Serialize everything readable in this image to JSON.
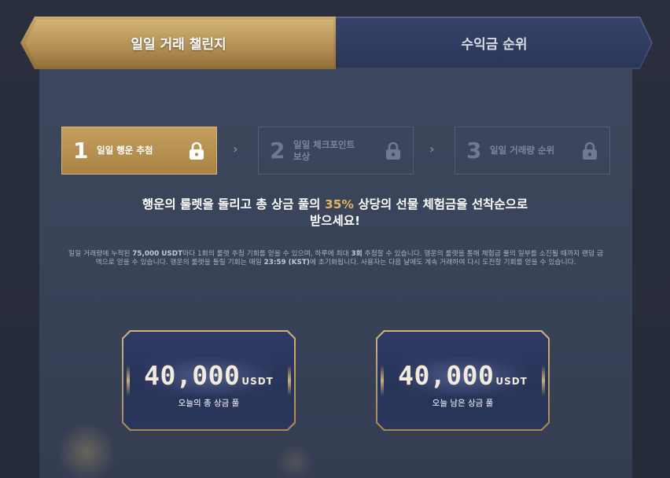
{
  "tabs": [
    {
      "label": "일일 거래 챌린지",
      "active": true
    },
    {
      "label": "수익금 순위",
      "active": false
    }
  ],
  "steps": [
    {
      "number": "1",
      "label": "일일 행운 추첨",
      "active": true,
      "icon": "lock-icon"
    },
    {
      "number": "2",
      "label_line1": "일일 체크포인트",
      "label_line2": "보상",
      "active": false,
      "icon": "lock-icon"
    },
    {
      "number": "3",
      "label": "일일 거래량 순위",
      "active": false,
      "icon": "lock-icon"
    }
  ],
  "headline": {
    "line1_before": "행운의 룰렛을 돌리고 총 상금 풀의 ",
    "percent": "35%",
    "line1_after": " 상당의 선물 체험금을 선착순으로",
    "line2": "받으세요!"
  },
  "description": {
    "p1": "일일 거래량에 누적된 ",
    "amount": "75,000 USDT",
    "p2": "마다 1회의 룰렛 추첨 기회를 얻을 수 있으며, 하루에 최대 ",
    "max": "3회",
    "p3": " 추첨할 수 있습니다. 행운의 룰렛을 통해 체험금 풀의 일부를 소진될 때까지 랜덤 금액으로 얻을 수 있습니다. 행운의 룰렛을 돌릴 기회는 매일 ",
    "time": "23:59 (KST)",
    "p4": "에 초기화됩니다. 사용자는 다음 날에도 계속 거래하여 다시 도전할 기회를 얻을 수 있습니다."
  },
  "prize_cards": [
    {
      "amount": "40,000",
      "unit": "USDT",
      "label": "오늘의 총 상금 풀"
    },
    {
      "amount": "40,000",
      "unit": "USDT",
      "label": "오늘 남은 상금 풀"
    }
  ],
  "colors": {
    "gold": "#c9a869",
    "highlight": "#e2b65c",
    "panel": "#3a4459",
    "navy": "#2c3658"
  }
}
